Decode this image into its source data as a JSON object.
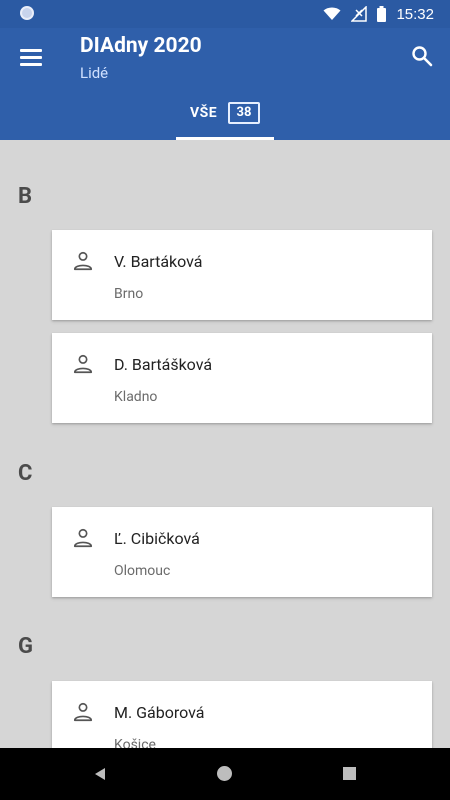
{
  "status": {
    "time": "15:32"
  },
  "app": {
    "title": "DIAdny 2020",
    "subtitle": "Lidé"
  },
  "tab": {
    "label": "VŠE",
    "count": "38"
  },
  "sections": [
    {
      "letter": "B",
      "people": [
        {
          "name": "V. Bartáková",
          "city": "Brno"
        },
        {
          "name": "D. Bartášková",
          "city": "Kladno"
        }
      ]
    },
    {
      "letter": "C",
      "people": [
        {
          "name": "Ľ. Cibičková",
          "city": "Olomouc"
        }
      ]
    },
    {
      "letter": "G",
      "people": [
        {
          "name": "M. Gáborová",
          "city": "Košice"
        }
      ]
    }
  ],
  "colors": {
    "primary": "#2f5faa",
    "statusbar": "#2b5aa3",
    "background": "#d6d6d6"
  },
  "icons": [
    "menu-icon",
    "search-icon",
    "person-icon",
    "wifi-icon",
    "signal-icon",
    "battery-icon",
    "back-icon",
    "home-icon",
    "recents-icon"
  ]
}
